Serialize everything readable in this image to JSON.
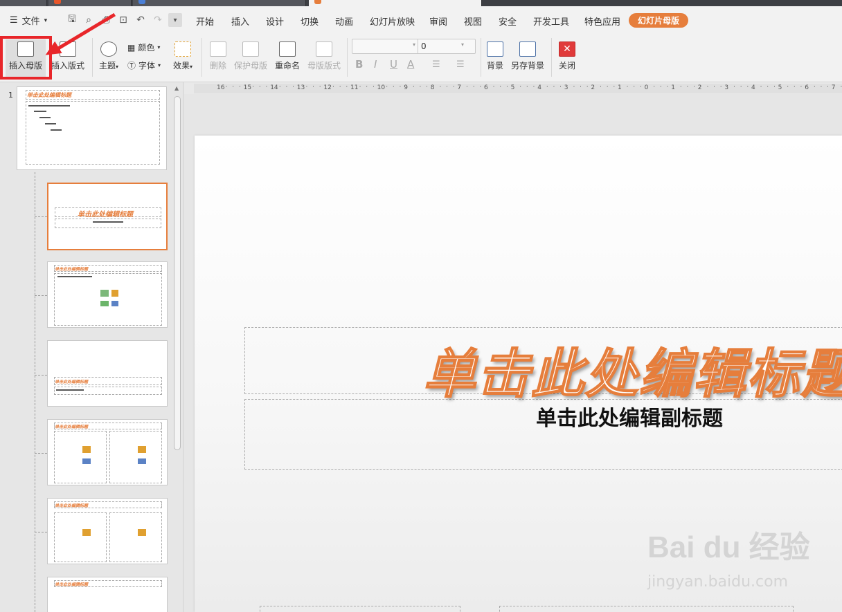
{
  "menubar": {
    "file_label": "文件",
    "tabs": [
      "开始",
      "插入",
      "设计",
      "切换",
      "动画",
      "幻灯片放映",
      "审阅",
      "视图",
      "安全",
      "开发工具",
      "特色应用"
    ],
    "active_tab": "幻灯片母版"
  },
  "ribbon": {
    "insert_master": "插入母版",
    "insert_layout": "插入版式",
    "theme": "主题",
    "color": "颜色",
    "font": "字体",
    "effect": "效果",
    "delete": "删除",
    "protect_master": "保护母版",
    "rename": "重命名",
    "master_layout": "母版版式",
    "font_size_value": "0",
    "background": "背景",
    "save_background": "另存背景",
    "close": "关闭"
  },
  "thumbnails": {
    "master_number": "1",
    "placeholder_title": "单击此处编辑标题"
  },
  "ruler_ticks": [
    "16",
    "15",
    "14",
    "13",
    "12",
    "11",
    "10",
    "9",
    "8",
    "7",
    "6",
    "5",
    "4",
    "3",
    "2",
    "1",
    "0",
    "1",
    "2",
    "3",
    "4",
    "5",
    "6",
    "7"
  ],
  "slide": {
    "title": "单击此处编辑标题",
    "subtitle": "单击此处编辑副标题"
  },
  "watermark": {
    "logo": "Bai du 经验",
    "url": "jingyan.baidu.com"
  },
  "colors": {
    "accent": "#e67e3c",
    "annotation": "#e8262a"
  }
}
